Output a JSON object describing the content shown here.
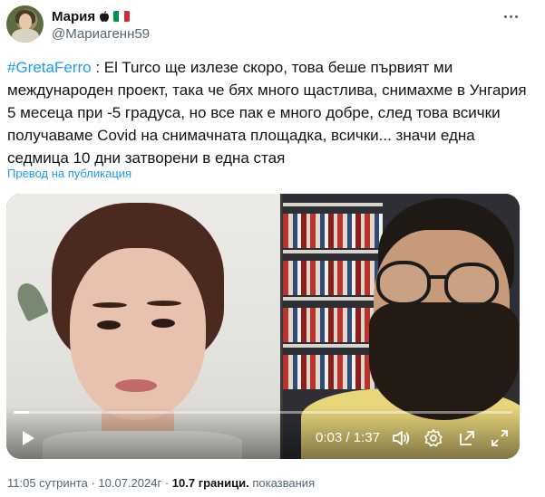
{
  "user": {
    "display_name": "Мария",
    "handle": "@Мариагенн59",
    "avatar_icon": "avatar-photo",
    "badges": [
      "apple-icon",
      "italy-flag-icon"
    ],
    "flag_colors": [
      "#009246",
      "#ffffff",
      "#ce2b37"
    ]
  },
  "tweet": {
    "hashtag": "#GretaFerro",
    "text": " : El Turco ще излезе скоро, това беше първият ми международен проект, така че бях много щастлива, снимахме в Унгария 5 месеца при -5 градуса, но все пак е много добре, след това всички получаваме Covid на снимачната площадка, всички... значи една седмица 10 дни затворени в една стая",
    "translate_label": "Превод на публикация"
  },
  "video": {
    "current_time": "0:03",
    "separator": " / ",
    "duration": "1:37",
    "progress": 0.03
  },
  "meta": {
    "time": "11:05 сутринта",
    "dot1": " · ",
    "date": "10.07.2024г",
    "dot2": " · ",
    "views_count": "10.7 граници.",
    "views_label": " показвания"
  },
  "colors": {
    "accent": "#1d9bf0",
    "text": "#0f1419",
    "muted": "#536471"
  }
}
